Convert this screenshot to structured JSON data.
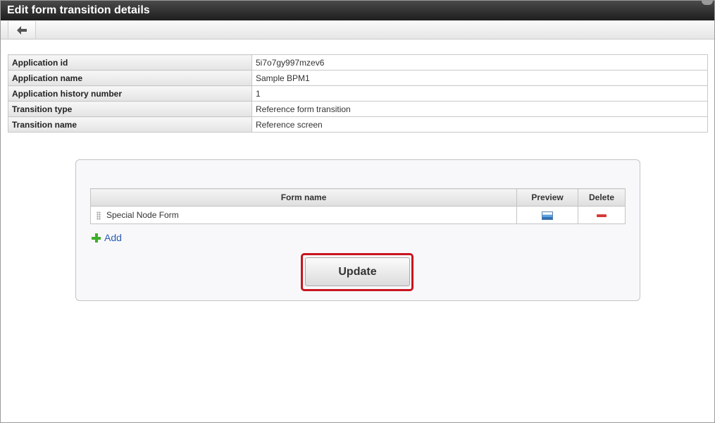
{
  "window": {
    "title": "Edit form transition details"
  },
  "toolbar": {
    "back_icon": "arrow-left-icon"
  },
  "details": [
    {
      "label": "Application id",
      "value": "5i7o7gy997mzev6"
    },
    {
      "label": "Application name",
      "value": "Sample BPM1"
    },
    {
      "label": "Application history number",
      "value": "1"
    },
    {
      "label": "Transition type",
      "value": "Reference form transition"
    },
    {
      "label": "Transition name",
      "value": "Reference screen"
    }
  ],
  "forms_table": {
    "headers": {
      "form_name": "Form name",
      "preview": "Preview",
      "delete": "Delete"
    },
    "rows": [
      {
        "form_name": "Special Node Form",
        "preview_icon": "image-preview-icon",
        "delete_icon": "minus-icon"
      }
    ]
  },
  "add_link": {
    "label": "Add",
    "icon": "plus-icon"
  },
  "update_button": {
    "label": "Update"
  },
  "colors": {
    "highlight": "#c8141e",
    "link": "#2a5db0",
    "delete": "#d43a3a",
    "add": "#3fae2a"
  }
}
